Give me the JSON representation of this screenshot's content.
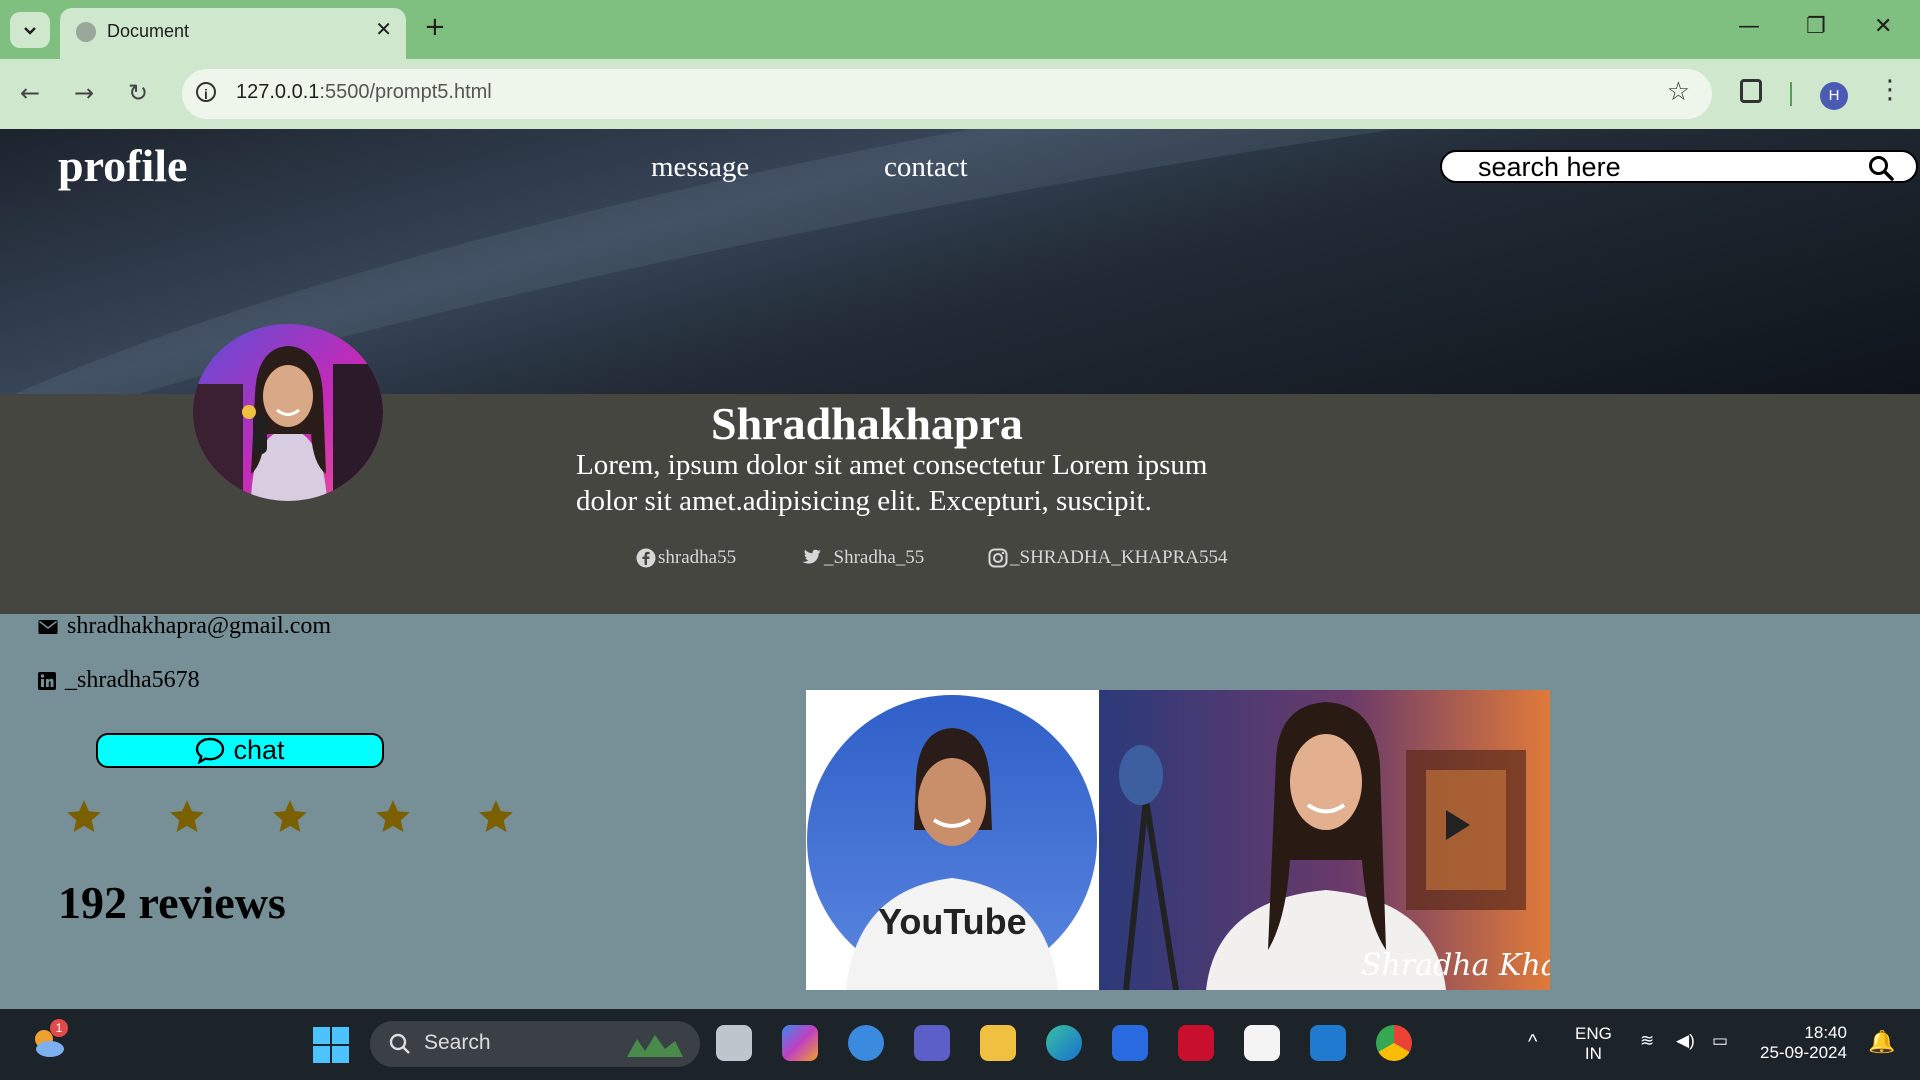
{
  "browser": {
    "tab_title": "Document",
    "url_host": "127.0.0.1",
    "url_rest": ":5500/prompt5.html",
    "profile_initial": "H"
  },
  "nav": {
    "brand": "profile",
    "links": [
      "message",
      "contact"
    ],
    "search_placeholder": "search here"
  },
  "profile": {
    "name": "Shradhakhapra",
    "bio_line1": "Lorem, ipsum dolor sit amet consectetur Lorem ipsum",
    "bio_line2": "dolor sit amet.adipisicing elit. Excepturi, suscipit.",
    "socials": {
      "facebook": "shradha55",
      "twitter": "_Shradha_55",
      "instagram": "_SHRADHA_KHAPRA554"
    }
  },
  "contact": {
    "email": "shradhakhapra@gmail.com",
    "linkedin": "_shradha5678"
  },
  "chat_label": "chat",
  "rating": {
    "value": 5,
    "max": 5,
    "color": "#7a6000"
  },
  "reviews_label": "192 reviews",
  "photo": {
    "shirt_text": "YouTube",
    "signature": "Shradha Khapra"
  },
  "taskbar": {
    "search_label": "Search",
    "lang_line1": "ENG",
    "lang_line2": "IN",
    "time": "18:40",
    "date": "25-09-2024",
    "weather_badge": "1"
  },
  "colors": {
    "chrome_green": "#7fbf7f",
    "chat_button": "#00ffff",
    "banner": "#464641",
    "page_bg": "#778f96"
  }
}
